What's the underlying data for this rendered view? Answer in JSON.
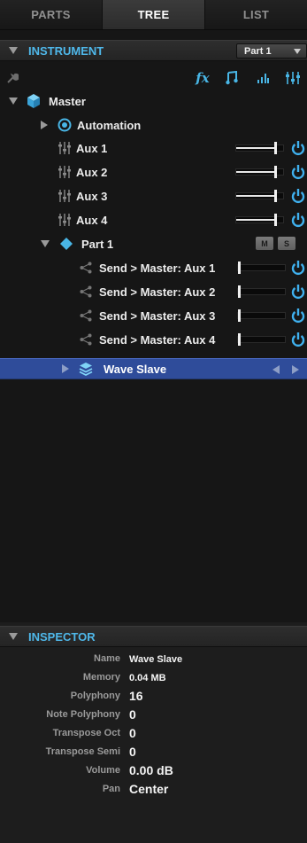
{
  "tabs": [
    {
      "label": "PARTS",
      "active": false
    },
    {
      "label": "TREE",
      "active": true
    },
    {
      "label": "LIST",
      "active": false
    }
  ],
  "instrument": {
    "title": "INSTRUMENT",
    "part_select": "Part 1"
  },
  "toolbar": {
    "left_icon": "wrench-icon",
    "icons": [
      "fx-icon",
      "note-icon",
      "levels-icon",
      "mixer-icon"
    ],
    "fx_label": "fx"
  },
  "tree": {
    "master": {
      "label": "Master",
      "icon": "cube-icon"
    },
    "automation": {
      "label": "Automation",
      "icon": "target-icon"
    },
    "aux": [
      {
        "label": "Aux 1",
        "level": 0.8,
        "power": true
      },
      {
        "label": "Aux 2",
        "level": 0.8,
        "power": true
      },
      {
        "label": "Aux 3",
        "level": 0.8,
        "power": true
      },
      {
        "label": "Aux 4",
        "level": 0.8,
        "power": true
      }
    ],
    "part": {
      "label": "Part 1",
      "icon": "diamond-icon",
      "mute_label": "M",
      "solo_label": "S"
    },
    "sends": [
      {
        "label": "Send > Master: Aux 1",
        "level": 0.0,
        "power": true
      },
      {
        "label": "Send > Master: Aux 2",
        "level": 0.0,
        "power": true
      },
      {
        "label": "Send > Master: Aux 3",
        "level": 0.0,
        "power": true
      },
      {
        "label": "Send > Master: Aux 4",
        "level": 0.0,
        "power": true
      }
    ],
    "selected": {
      "label": "Wave Slave",
      "icon": "layers-icon"
    }
  },
  "inspector": {
    "title": "INSPECTOR",
    "fields": [
      {
        "label": "Name",
        "value": "Wave Slave",
        "size": "sm"
      },
      {
        "label": "Memory",
        "value": "0.04 MB",
        "size": "sm"
      },
      {
        "label": "Polyphony",
        "value": "16",
        "size": "lg"
      },
      {
        "label": "Note Polyphony",
        "value": "0",
        "size": "lg"
      },
      {
        "label": "Transpose Oct",
        "value": "0",
        "size": "lg"
      },
      {
        "label": "Transpose Semi",
        "value": "0",
        "size": "lg"
      },
      {
        "label": "Volume",
        "value": "0.00 dB",
        "size": "lg"
      },
      {
        "label": "Pan",
        "value": "Center",
        "size": "lg"
      }
    ]
  },
  "colors": {
    "accent": "#4fb8ea",
    "power_on": "#3fb0ee",
    "selection": "#2f4c9a",
    "background": "#161616"
  }
}
